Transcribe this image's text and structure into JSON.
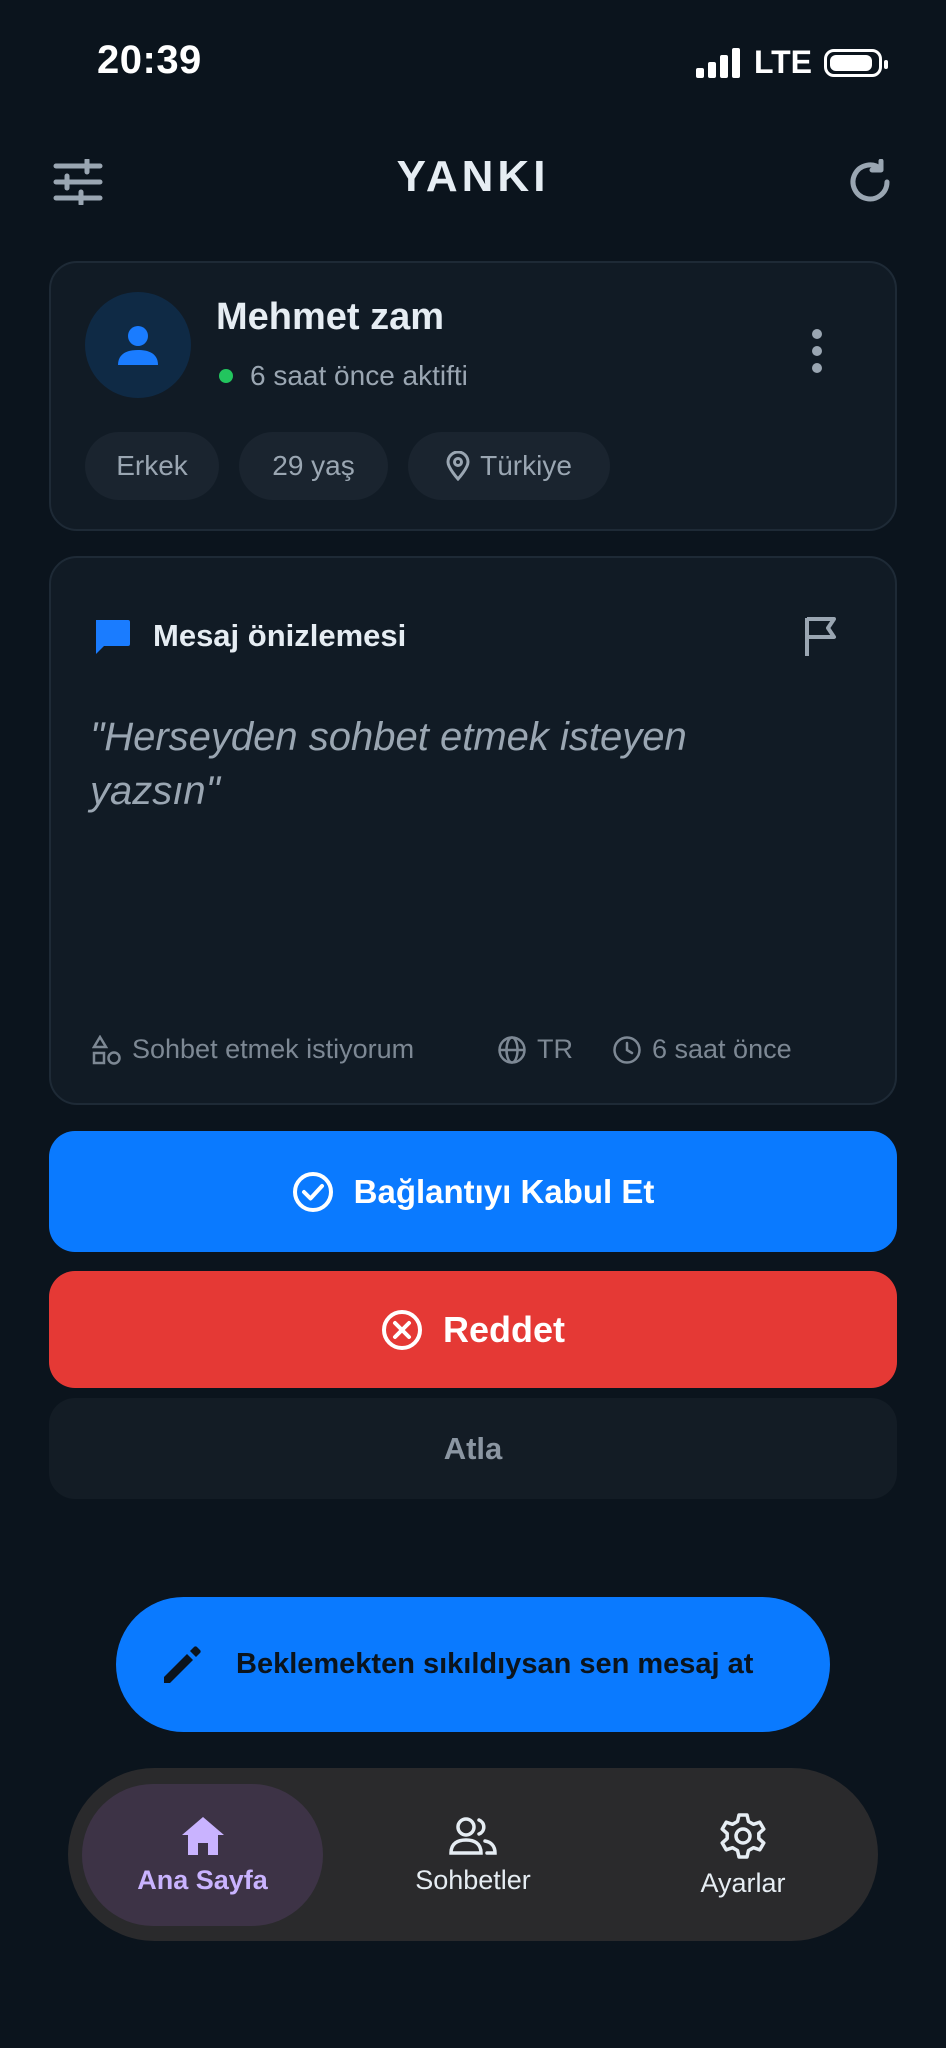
{
  "status_bar": {
    "time": "20:39",
    "network": "LTE"
  },
  "header": {
    "title": "YANKI"
  },
  "profile": {
    "name": "Mehmet zam",
    "last_active": "6 saat önce aktifti",
    "chips": {
      "gender": "Erkek",
      "age": "29 yaş",
      "location": "Türkiye"
    }
  },
  "message": {
    "section_title": "Mesaj önizlemesi",
    "quote_line1": "\"Herseyden sohbet etmek isteyen",
    "quote_line2": "yazsın\"",
    "meta": {
      "intent": "Sohbet etmek istiyorum",
      "language": "TR",
      "time": "6 saat önce"
    }
  },
  "actions": {
    "accept_label": "Bağlantıyı Kabul Et",
    "reject_label": "Reddet",
    "skip_label": "Atla"
  },
  "fab": {
    "label": "Beklemekten sıkıldıysan sen mesaj at"
  },
  "bottom_nav": {
    "items": [
      {
        "label": "Ana Sayfa",
        "icon": "home-icon",
        "active": true
      },
      {
        "label": "Sohbetler",
        "icon": "people-icon",
        "active": false
      },
      {
        "label": "Ayarlar",
        "icon": "gear-icon",
        "active": false
      }
    ]
  },
  "colors": {
    "background": "#0b141d",
    "primary": "#0a7aff",
    "danger": "#e53935",
    "online": "#22c55e",
    "nav_active": "#c9b3ff"
  }
}
